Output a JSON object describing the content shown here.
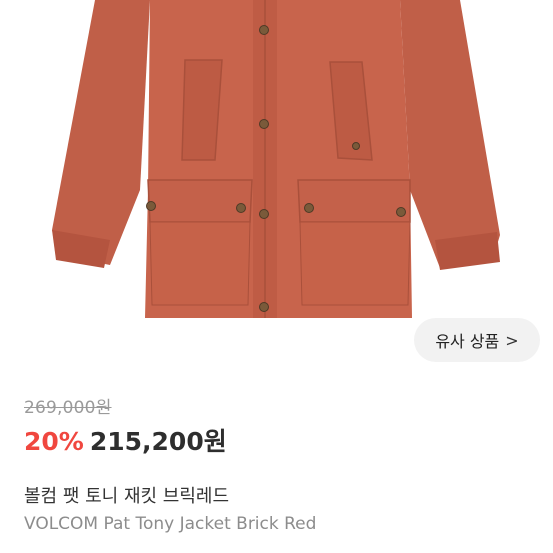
{
  "product": {
    "image_alt": "VOLCOM Pat Tony Jacket Brick Red product photo",
    "similar_products_label": "유사 상품",
    "similar_products_icon": "chevron-right-icon",
    "original_price": "269,000원",
    "discount": "20%",
    "sale_price": "215,200원",
    "title_ko": "볼컴 팻 토니 재킷 브릭레드",
    "title_en": "VOLCOM Pat Tony Jacket Brick Red"
  },
  "colors": {
    "jacket": "#c8644c",
    "discount": "#f0473f",
    "button_bg": "#f2f2f2"
  }
}
